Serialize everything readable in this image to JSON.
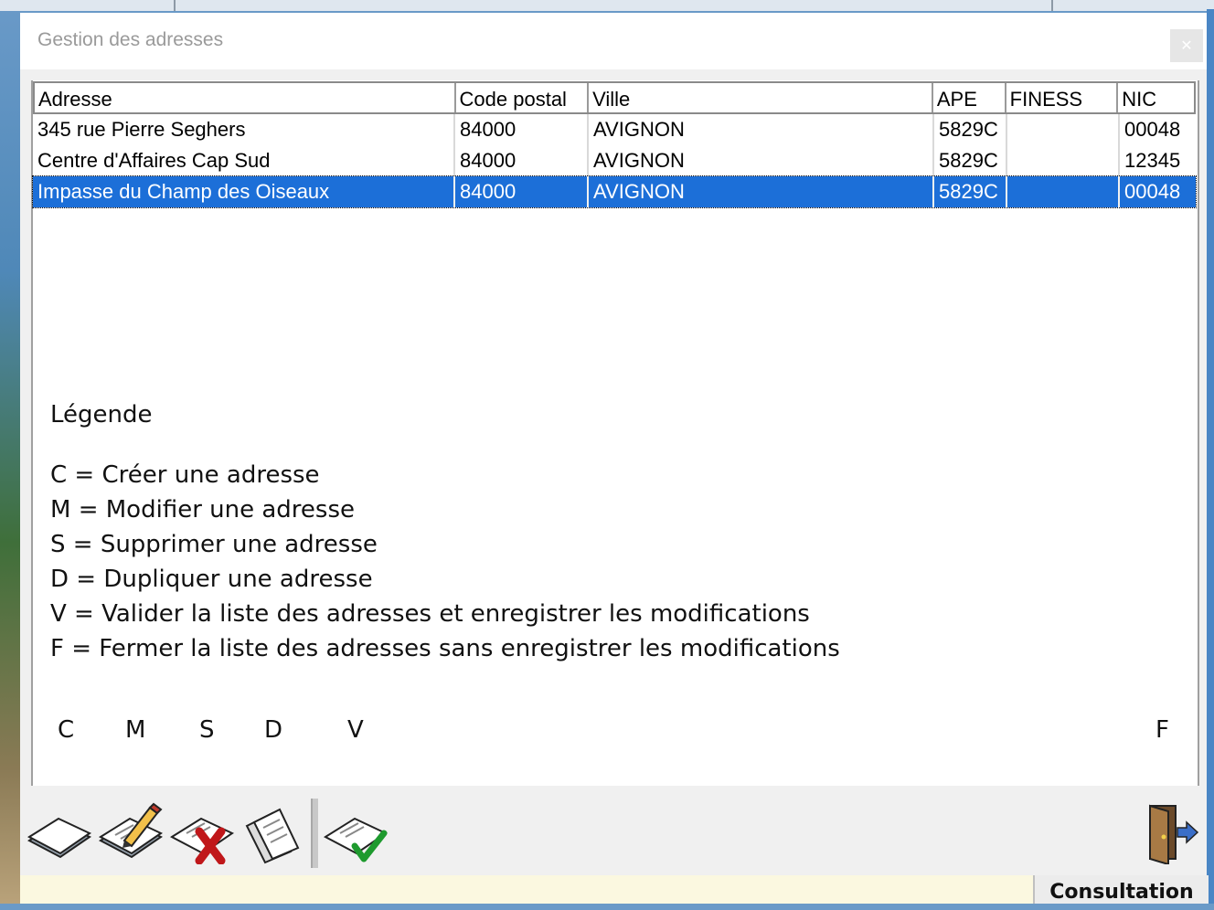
{
  "window": {
    "title": "Gestion des adresses",
    "close_label": "✕"
  },
  "table": {
    "columns": [
      "Adresse",
      "Code postal",
      "Ville",
      "APE",
      "FINESS",
      "NIC"
    ],
    "rows": [
      [
        "345 rue Pierre Seghers",
        "84000",
        "AVIGNON",
        "5829C",
        "",
        "00048"
      ],
      [
        "Centre d'Affaires Cap Sud",
        "84000",
        "AVIGNON",
        "5829C",
        "",
        "12345"
      ],
      [
        "Impasse du Champ des Oiseaux",
        "84000",
        "AVIGNON",
        "5829C",
        "",
        "00048"
      ]
    ],
    "selected_row": 2
  },
  "legend": {
    "title": "Légende",
    "lines": [
      "C = Créer une adresse",
      "M = Modifier une adresse",
      "S = Supprimer une adresse",
      "D = Dupliquer une adresse",
      "V = Valider la liste des adresses et enregistrer les modifications",
      "F = Fermer la liste des adresses sans enregistrer les modifications"
    ],
    "letters": [
      "C",
      "M",
      "S",
      "D",
      "V",
      "F"
    ]
  },
  "toolbar": {
    "buttons": [
      {
        "name": "create",
        "icon": "blank-document-icon"
      },
      {
        "name": "modify",
        "icon": "edit-pencil-icon"
      },
      {
        "name": "delete",
        "icon": "delete-x-icon"
      },
      {
        "name": "duplicate",
        "icon": "copy-documents-icon"
      },
      {
        "name": "validate",
        "icon": "validate-check-icon"
      },
      {
        "name": "close",
        "icon": "exit-door-icon"
      }
    ]
  },
  "status": {
    "mode": "Consultation"
  }
}
